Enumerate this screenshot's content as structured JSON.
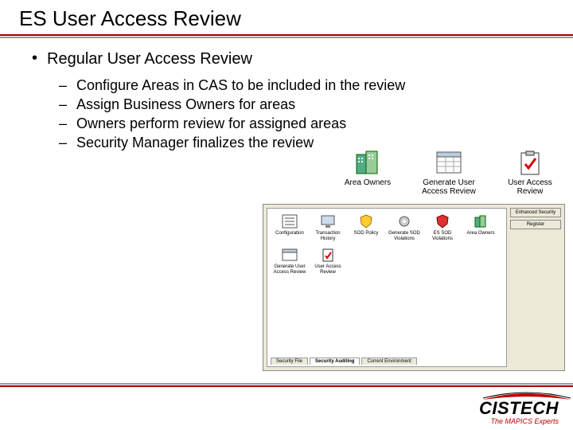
{
  "title": "ES User Access Review",
  "bullet": "Regular User Access Review",
  "subitems": [
    "Configure Areas in CAS to be included in the review",
    "Assign Business Owners for areas",
    "Owners perform review for assigned areas",
    "Security Manager finalizes the review"
  ],
  "top_icons": [
    {
      "label": "Area Owners",
      "icon": "building"
    },
    {
      "label": "Generate User Access Review",
      "icon": "window"
    },
    {
      "label": "User Access Review",
      "icon": "clipboard-check"
    }
  ],
  "app_icons": [
    {
      "label": "Configuration",
      "icon": "list"
    },
    {
      "label": "Transaction History",
      "icon": "monitor"
    },
    {
      "label": "SOD Policy",
      "icon": "shield-yellow"
    },
    {
      "label": "Generate SOD Violations",
      "icon": "gear"
    },
    {
      "label": "ES SOD Violations",
      "icon": "shield-red"
    },
    {
      "label": "Area Owners",
      "icon": "building-small"
    },
    {
      "label": "Generate User Access Review",
      "icon": "window-small"
    },
    {
      "label": "User Access Review",
      "icon": "clipboard-small"
    }
  ],
  "tabs": [
    "Security File",
    "Security Auditing",
    "Current Environment"
  ],
  "active_tab": 1,
  "side_buttons": [
    "Enhanced Security",
    "Register"
  ],
  "brand": "CISTECH",
  "tagline": "The MAPICS Experts"
}
